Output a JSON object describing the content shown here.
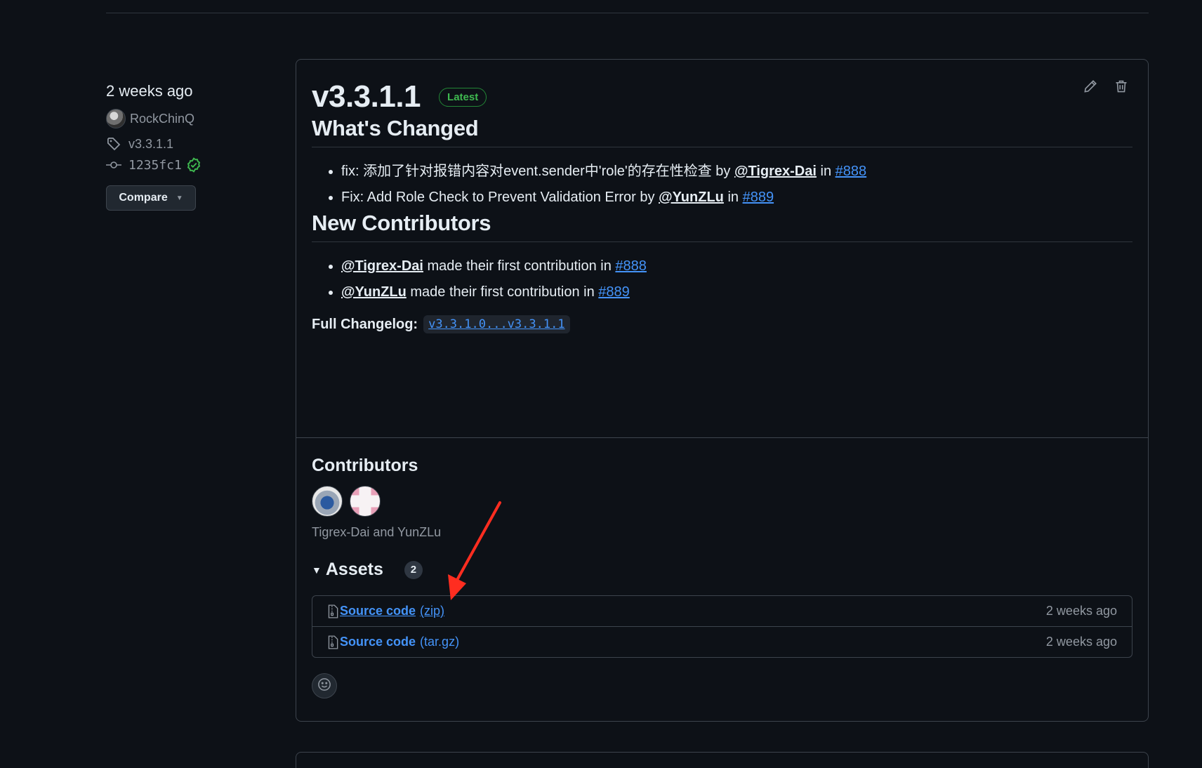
{
  "release": {
    "date_relative": "2 weeks ago",
    "author": "RockChinQ",
    "tag": "v3.3.1.1",
    "commit": "1235fc1",
    "compare_label": "Compare",
    "title": "v3.3.1.1",
    "latest_badge": "Latest"
  },
  "notes": {
    "whats_changed_heading": "What's Changed",
    "changes": [
      {
        "prefix": "fix: 添加了针对报错内容对event.sender中'role'的存在性检查 by ",
        "author": "@Tigrex-Dai",
        "mid": " in ",
        "pr": "#888"
      },
      {
        "prefix": "Fix: Add Role Check to Prevent Validation Error by ",
        "author": "@YunZLu",
        "mid": " in ",
        "pr": "#889"
      }
    ],
    "new_contributors_heading": "New Contributors",
    "new_contributors": [
      {
        "user": "@Tigrex-Dai",
        "text": " made their first contribution in ",
        "pr": "#888"
      },
      {
        "user": "@YunZLu",
        "text": " made their first contribution in ",
        "pr": "#889"
      }
    ],
    "full_changelog_label": "Full Changelog:",
    "full_changelog_link": "v3.3.1.0...v3.3.1.1"
  },
  "contributors": {
    "heading": "Contributors",
    "names_text": "Tigrex-Dai and YunZLu"
  },
  "assets": {
    "heading": "Assets",
    "count": "2",
    "items": [
      {
        "name": "Source code",
        "ext": "(zip)",
        "date": "2 weeks ago"
      },
      {
        "name": "Source code",
        "ext": "(tar.gz)",
        "date": "2 weeks ago"
      }
    ]
  },
  "colors": {
    "background": "#0d1117",
    "border": "#3d444d",
    "link": "#4493f8",
    "latest_green": "#3fb950",
    "annotation_arrow": "#ff2d20"
  },
  "icons": [
    "tag-icon",
    "commit-icon",
    "verified-check-icon",
    "caret-down-icon",
    "pencil-icon",
    "trash-icon",
    "file-zip-icon",
    "smiley-icon"
  ]
}
